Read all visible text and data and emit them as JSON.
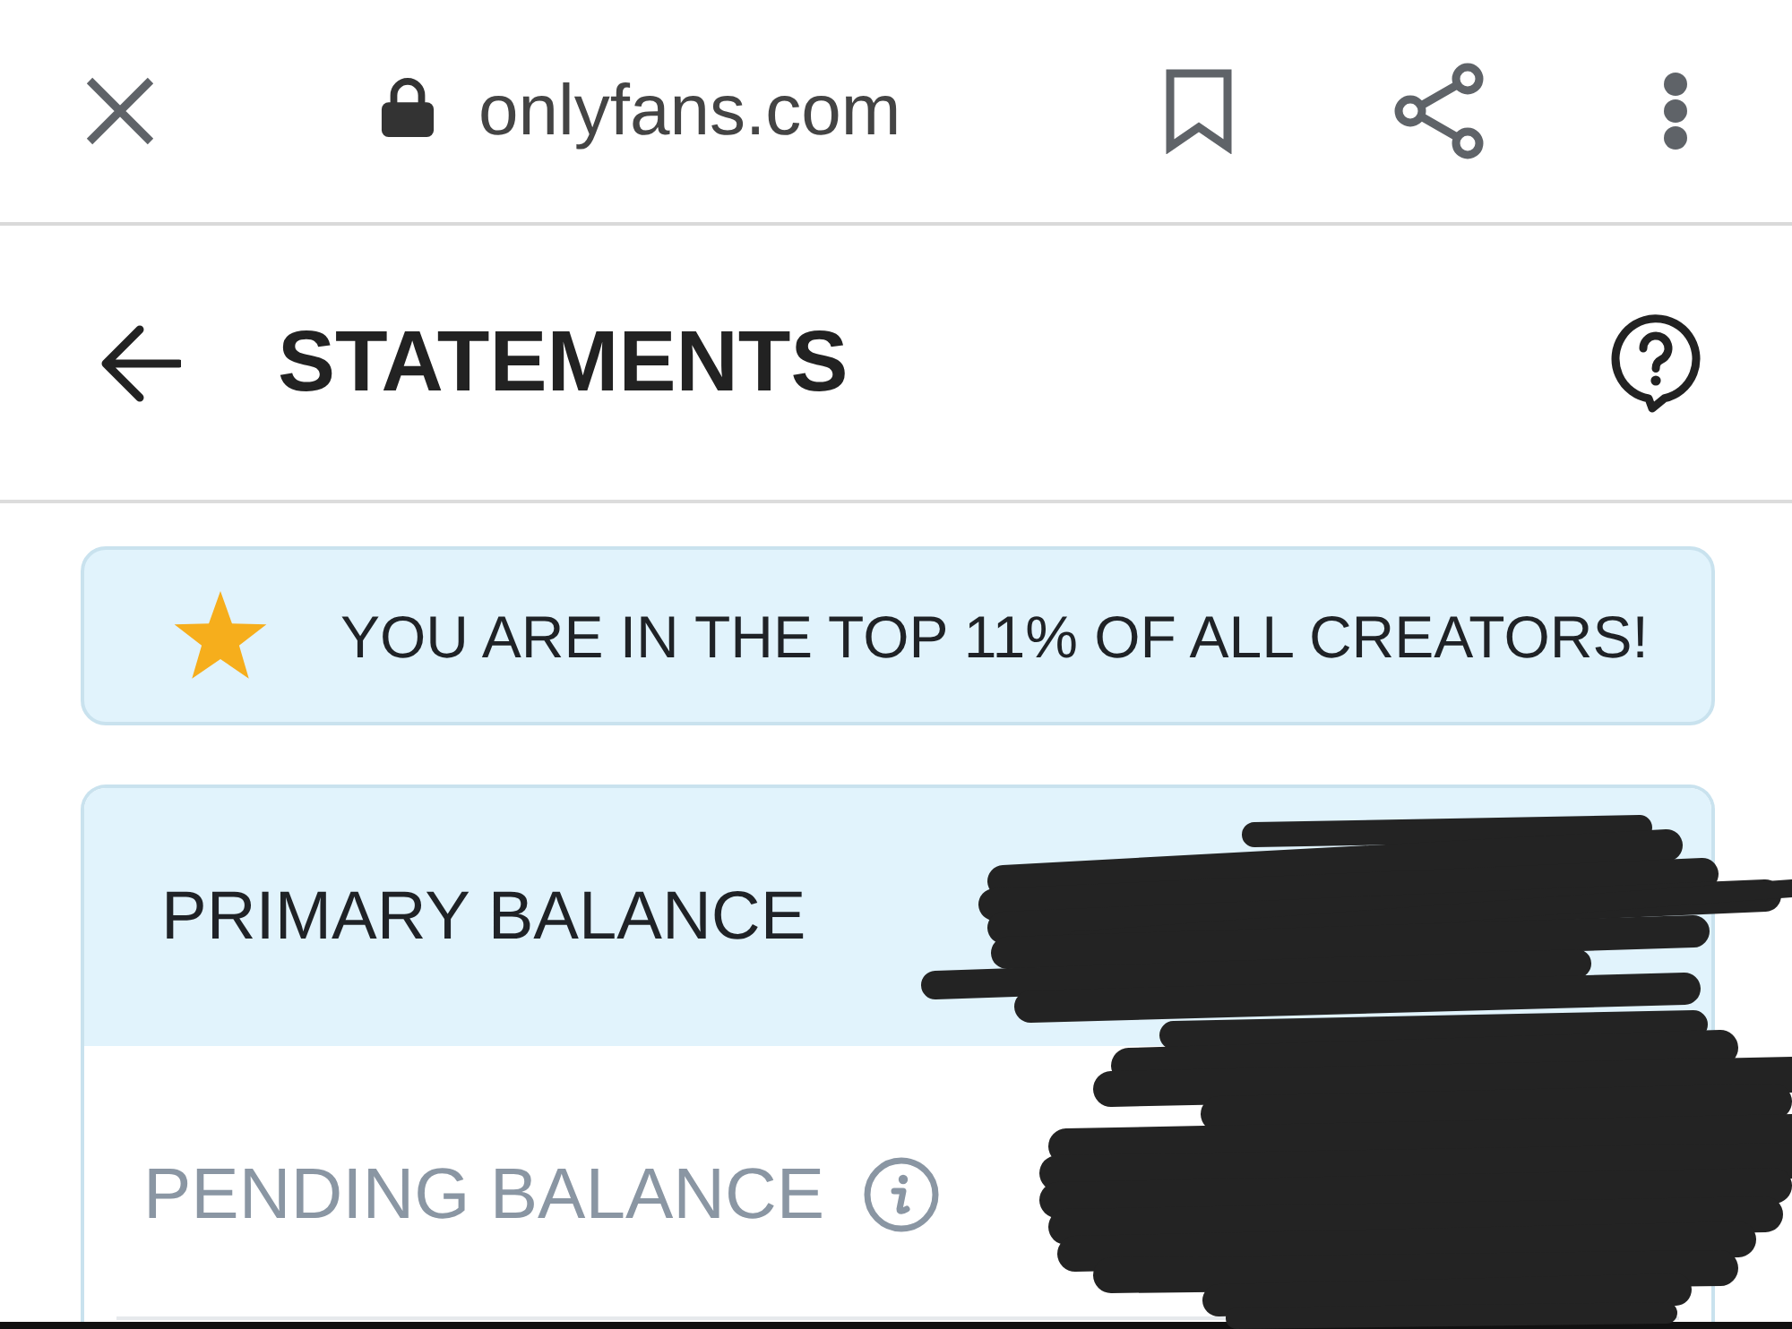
{
  "browser_bar": {
    "url": "onlyfans.com"
  },
  "header": {
    "title": "STATEMENTS"
  },
  "banner": {
    "text": "YOU ARE IN THE TOP 11% OF ALL CREATORS!"
  },
  "balances": [
    {
      "label": "PRIMARY BALANCE",
      "kind": "primary"
    },
    {
      "label": "PENDING BALANCE",
      "kind": "pending"
    }
  ]
}
